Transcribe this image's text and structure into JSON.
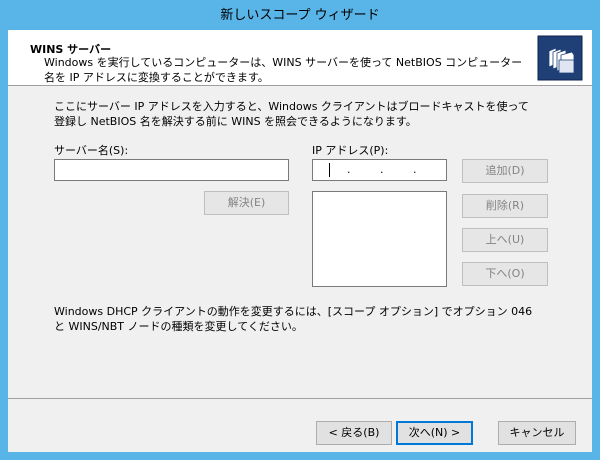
{
  "window": {
    "title": "新しいスコープ ウィザード"
  },
  "header": {
    "title": "WINS サーバー",
    "description": "Windows を実行しているコンピューターは、WINS サーバーを使って NetBIOS コンピューター名を IP アドレスに変換することができます。",
    "icon": "wizard-folders-icon"
  },
  "body": {
    "intro": "ここにサーバー IP アドレスを入力すると、Windows クライアントはブロードキャストを使って登録し NetBIOS 名を解決する前に WINS を照会できるようになります。",
    "server_name_label": "サーバー名(S):",
    "server_name_value": "",
    "ip_label": "IP アドレス(P):",
    "ip_segments": [
      "",
      "",
      "",
      ""
    ],
    "ip_dot": ".",
    "resolve_button": "解決(E)",
    "add_button": "追加(D)",
    "remove_button": "削除(R)",
    "up_button": "上へ(U)",
    "down_button": "下へ(O)",
    "note": "Windows DHCP クライアントの動作を変更するには、[スコープ オプション] でオプション 046 と WINS/NBT ノードの種類を変更してください。"
  },
  "footer": {
    "back_button": "< 戻る(B)",
    "next_button": "次へ(N) >",
    "cancel_button": "キャンセル"
  },
  "colors": {
    "frame": "#59b5e8",
    "dialog_bg": "#f0f0f0",
    "default_button_border": "#0078d7"
  }
}
